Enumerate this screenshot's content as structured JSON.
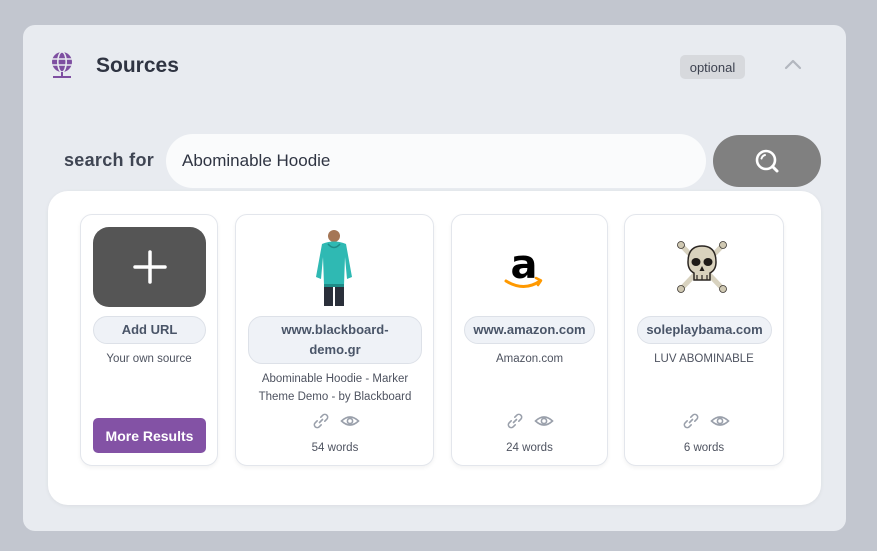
{
  "header": {
    "title": "Sources",
    "badge": "optional",
    "icon": "globe-network-icon",
    "accent": "#7e4fa1"
  },
  "search": {
    "label": "search for",
    "value": "Abominable Hoodie"
  },
  "add_card": {
    "button_label": "Add URL",
    "description": "Your own source",
    "more_label": "More Results"
  },
  "sources": [
    {
      "domain": "www.blackboard-demo.gr",
      "domain_line1": "www.blackboard-",
      "domain_line2": "demo.gr",
      "description_line1": "Abominable Hoodie - Marker",
      "description_line2": "Theme Demo - by Blackboard",
      "words": "54 words",
      "thumbnail": "hoodie-person-image"
    },
    {
      "domain": "www.amazon.com",
      "description": "Amazon.com",
      "words": "24 words",
      "thumbnail": "amazon-logo"
    },
    {
      "domain": "soleplaybama.com",
      "description": "LUV ABOMINABLE",
      "words": "6 words",
      "thumbnail": "skull-crossbones-image"
    }
  ],
  "colors": {
    "search_button": "#808080",
    "more_button": "#8352a5",
    "add_box": "#555555"
  }
}
